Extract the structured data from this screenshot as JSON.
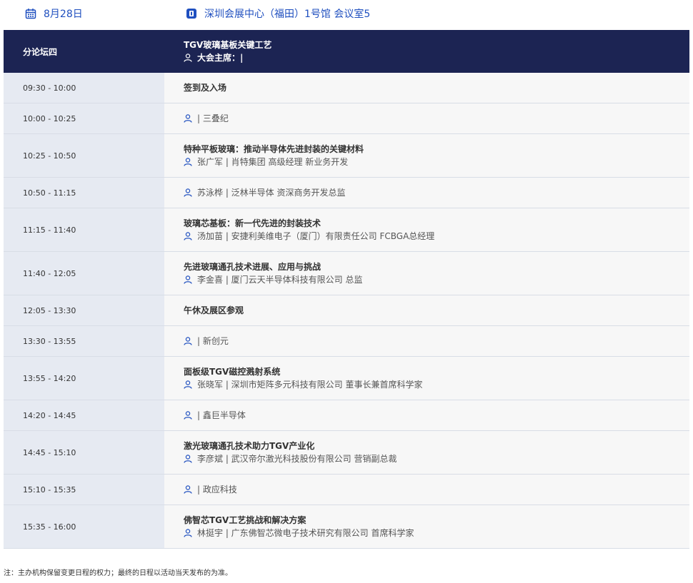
{
  "header": {
    "date": "8月28日",
    "venue": "深圳会展中心（福田）1号馆 会议室5",
    "accent_color": "#1f4fbf"
  },
  "table_head": {
    "forum": "分论坛四",
    "topic": "TGV玻璃基板关键工艺",
    "chair": "大会主席：|"
  },
  "rows": [
    {
      "time": "09:30 - 10:00",
      "title": "签到及入场",
      "speaker": ""
    },
    {
      "time": "10:00 - 10:25",
      "title": "",
      "speaker": "| 三叠纪"
    },
    {
      "time": "10:25 - 10:50",
      "title": "特种平板玻璃：推动半导体先进封装的关键材料",
      "speaker": "张广军 | 肖特集团 高级经理 新业务开发"
    },
    {
      "time": "10:50 - 11:15",
      "title": "",
      "speaker": "苏泳桦 | 泛林半导体 资深商务开发总监"
    },
    {
      "time": "11:15 - 11:40",
      "title": "玻璃芯基板：新一代先进的封装技术",
      "speaker": "汤加苗 | 安捷利美维电子（厦门）有限责任公司 FCBGA总经理"
    },
    {
      "time": "11:40 - 12:05",
      "title": "先进玻璃通孔技术进展、应用与挑战",
      "speaker": "李金喜 | 厦门云天半导体科技有限公司 总监"
    },
    {
      "time": "12:05 - 13:30",
      "title": "午休及展区参观",
      "speaker": ""
    },
    {
      "time": "13:30 - 13:55",
      "title": "",
      "speaker": "| 新创元"
    },
    {
      "time": "13:55 - 14:20",
      "title": "面板级TGV磁控溅射系统",
      "speaker": "张晓军 | 深圳市矩阵多元科技有限公司 董事长兼首席科学家"
    },
    {
      "time": "14:20 - 14:45",
      "title": "",
      "speaker": "| 鑫巨半导体"
    },
    {
      "time": "14:45 - 15:10",
      "title": "激光玻璃通孔技术助力TGV产业化",
      "speaker": "李彦斌 | 武汉帝尔激光科技股份有限公司 营销副总裁"
    },
    {
      "time": "15:10 - 15:35",
      "title": "",
      "speaker": "| 政应科技"
    },
    {
      "time": "15:35 - 16:00",
      "title": "佛智芯TGV工艺挑战和解决方案",
      "speaker": "林挺宇 | 广东佛智芯微电子技术研究有限公司 首席科学家"
    }
  ],
  "footer": {
    "note": "注：主办机构保留变更日程的权力；最终的日程以活动当天发布的为准。"
  }
}
